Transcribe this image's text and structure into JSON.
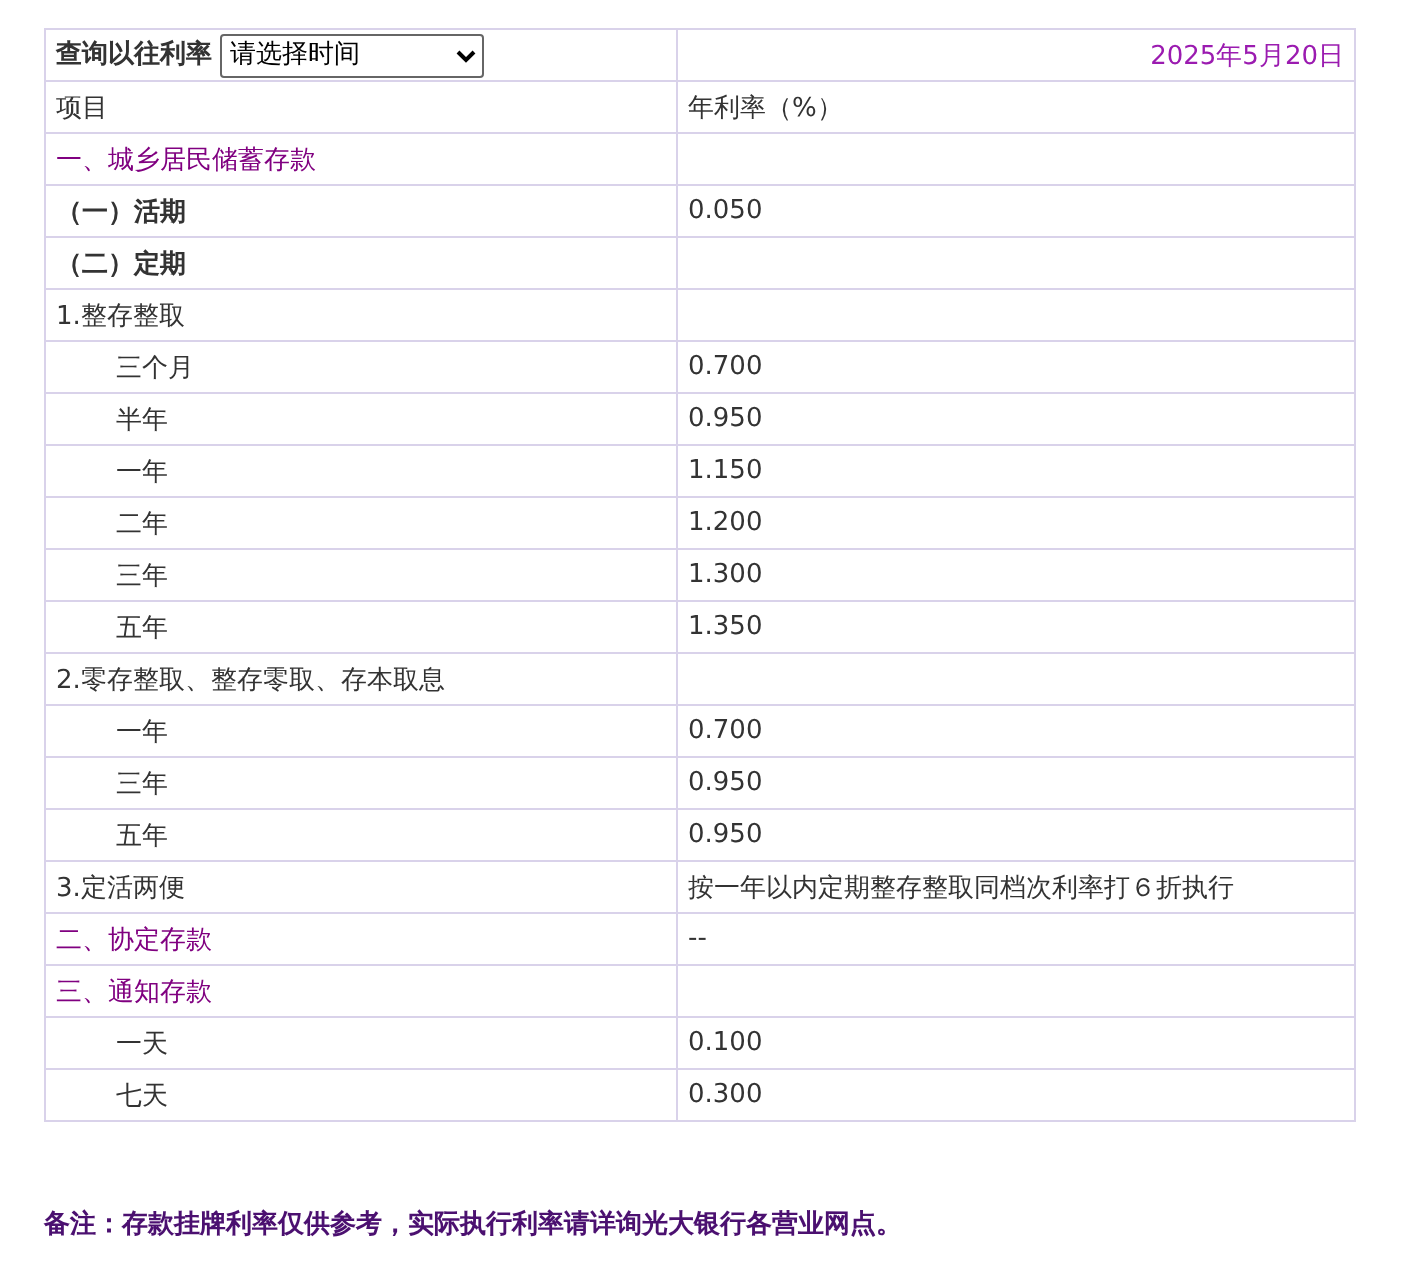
{
  "query": {
    "label": "查询以往利率",
    "select_value": "请选择时间",
    "date": "2025年5月20日"
  },
  "columns": [
    "项目",
    "年利率（%）"
  ],
  "rows": [
    {
      "kind": "section",
      "name": "一、城乡居民储蓄存款"
    },
    {
      "kind": "subsection",
      "name": "（一）活期",
      "rate": "0.050"
    },
    {
      "kind": "subsection",
      "name": "（二）定期"
    },
    {
      "kind": "group",
      "name": "1.整存整取"
    },
    {
      "kind": "item",
      "name": "三个月",
      "rate": "0.700"
    },
    {
      "kind": "item",
      "name": "半年",
      "rate": "0.950"
    },
    {
      "kind": "item",
      "name": "一年",
      "rate": "1.150"
    },
    {
      "kind": "item",
      "name": "二年",
      "rate": "1.200"
    },
    {
      "kind": "item",
      "name": "三年",
      "rate": "1.300"
    },
    {
      "kind": "item",
      "name": "五年",
      "rate": "1.350"
    },
    {
      "kind": "group",
      "name": "2.零存整取、整存零取、存本取息"
    },
    {
      "kind": "item",
      "name": "一年",
      "rate": "0.700"
    },
    {
      "kind": "item",
      "name": "三年",
      "rate": "0.950"
    },
    {
      "kind": "item",
      "name": "五年",
      "rate": "0.950"
    },
    {
      "kind": "group",
      "name": "3.定活两便",
      "rate": "按一年以内定期整存整取同档次利率打６折执行"
    },
    {
      "kind": "section",
      "name": "二、协定存款",
      "rate": "--"
    },
    {
      "kind": "section",
      "name": "三、通知存款"
    },
    {
      "kind": "item",
      "name": "一天",
      "rate": "0.100"
    },
    {
      "kind": "item",
      "name": "七天",
      "rate": "0.300"
    }
  ],
  "note": "备注：存款挂牌利率仅供参考，实际执行利率请详询光大银行各营业网点。"
}
